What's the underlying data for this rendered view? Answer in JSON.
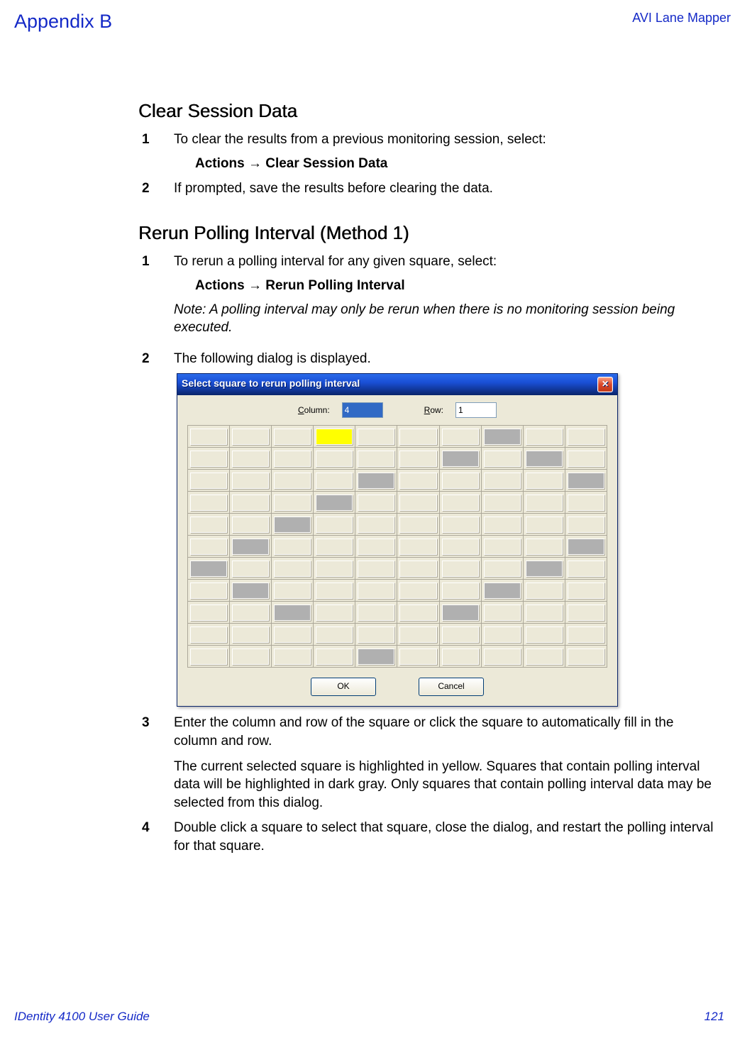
{
  "header": {
    "left": "Appendix B",
    "right": "AVI Lane Mapper"
  },
  "section1": {
    "title": "Clear Session Data",
    "steps": [
      {
        "num": "1",
        "text": "To clear the results from a previous monitoring session, select:",
        "menu": "Actions → Clear Session Data"
      },
      {
        "num": "2",
        "text": "If prompted, save the results before clearing the data."
      }
    ]
  },
  "section2": {
    "title": "Rerun Polling Interval (Method 1)",
    "steps": [
      {
        "num": "1",
        "text": "To rerun a polling interval for any given square, select:",
        "menu": "Actions → Rerun Polling Interval",
        "note": "Note: A polling interval may only be rerun when there is no monitoring session being executed."
      },
      {
        "num": "2",
        "text": "The following dialog is displayed."
      },
      {
        "num": "3",
        "text": "Enter the column and row of the square or click the square to automatically fill in the column and row.",
        "extra": "The current selected square is highlighted in yellow. Squares that contain polling interval data will be highlighted in dark gray. Only squares that contain polling interval data may be selected from this dialog."
      },
      {
        "num": "4",
        "text": "Double click a square to select that square, close the dialog, and restart the polling interval for that square."
      }
    ]
  },
  "dialog": {
    "title": "Select square to rerun polling interval",
    "col_label": "Column:",
    "row_label": "Row:",
    "col_value": "4",
    "row_value": "1",
    "ok": "OK",
    "cancel": "Cancel",
    "grid": [
      [
        "",
        "",
        "",
        "Y",
        "",
        "",
        "",
        "D",
        "",
        ""
      ],
      [
        "",
        "",
        "",
        "",
        "",
        "",
        "D",
        "",
        "D",
        ""
      ],
      [
        "",
        "",
        "",
        "",
        "D",
        "",
        "",
        "",
        "",
        "D"
      ],
      [
        "",
        "",
        "",
        "D",
        "",
        "",
        "",
        "",
        "",
        ""
      ],
      [
        "",
        "",
        "D",
        "",
        "",
        "",
        "",
        "",
        "",
        ""
      ],
      [
        "",
        "D",
        "",
        "",
        "",
        "",
        "",
        "",
        "",
        "D"
      ],
      [
        "D",
        "",
        "",
        "",
        "",
        "",
        "",
        "",
        "D",
        ""
      ],
      [
        "",
        "D",
        "",
        "",
        "",
        "",
        "",
        "D",
        "",
        ""
      ],
      [
        "",
        "",
        "D",
        "",
        "",
        "",
        "D",
        "",
        "",
        ""
      ],
      [
        "",
        "",
        "",
        "",
        "",
        "",
        "",
        "",
        "",
        ""
      ],
      [
        "",
        "",
        "",
        "",
        "D",
        "",
        "",
        "",
        "",
        ""
      ]
    ]
  },
  "footer": {
    "left": "IDentity 4100 User Guide",
    "right": "121"
  }
}
